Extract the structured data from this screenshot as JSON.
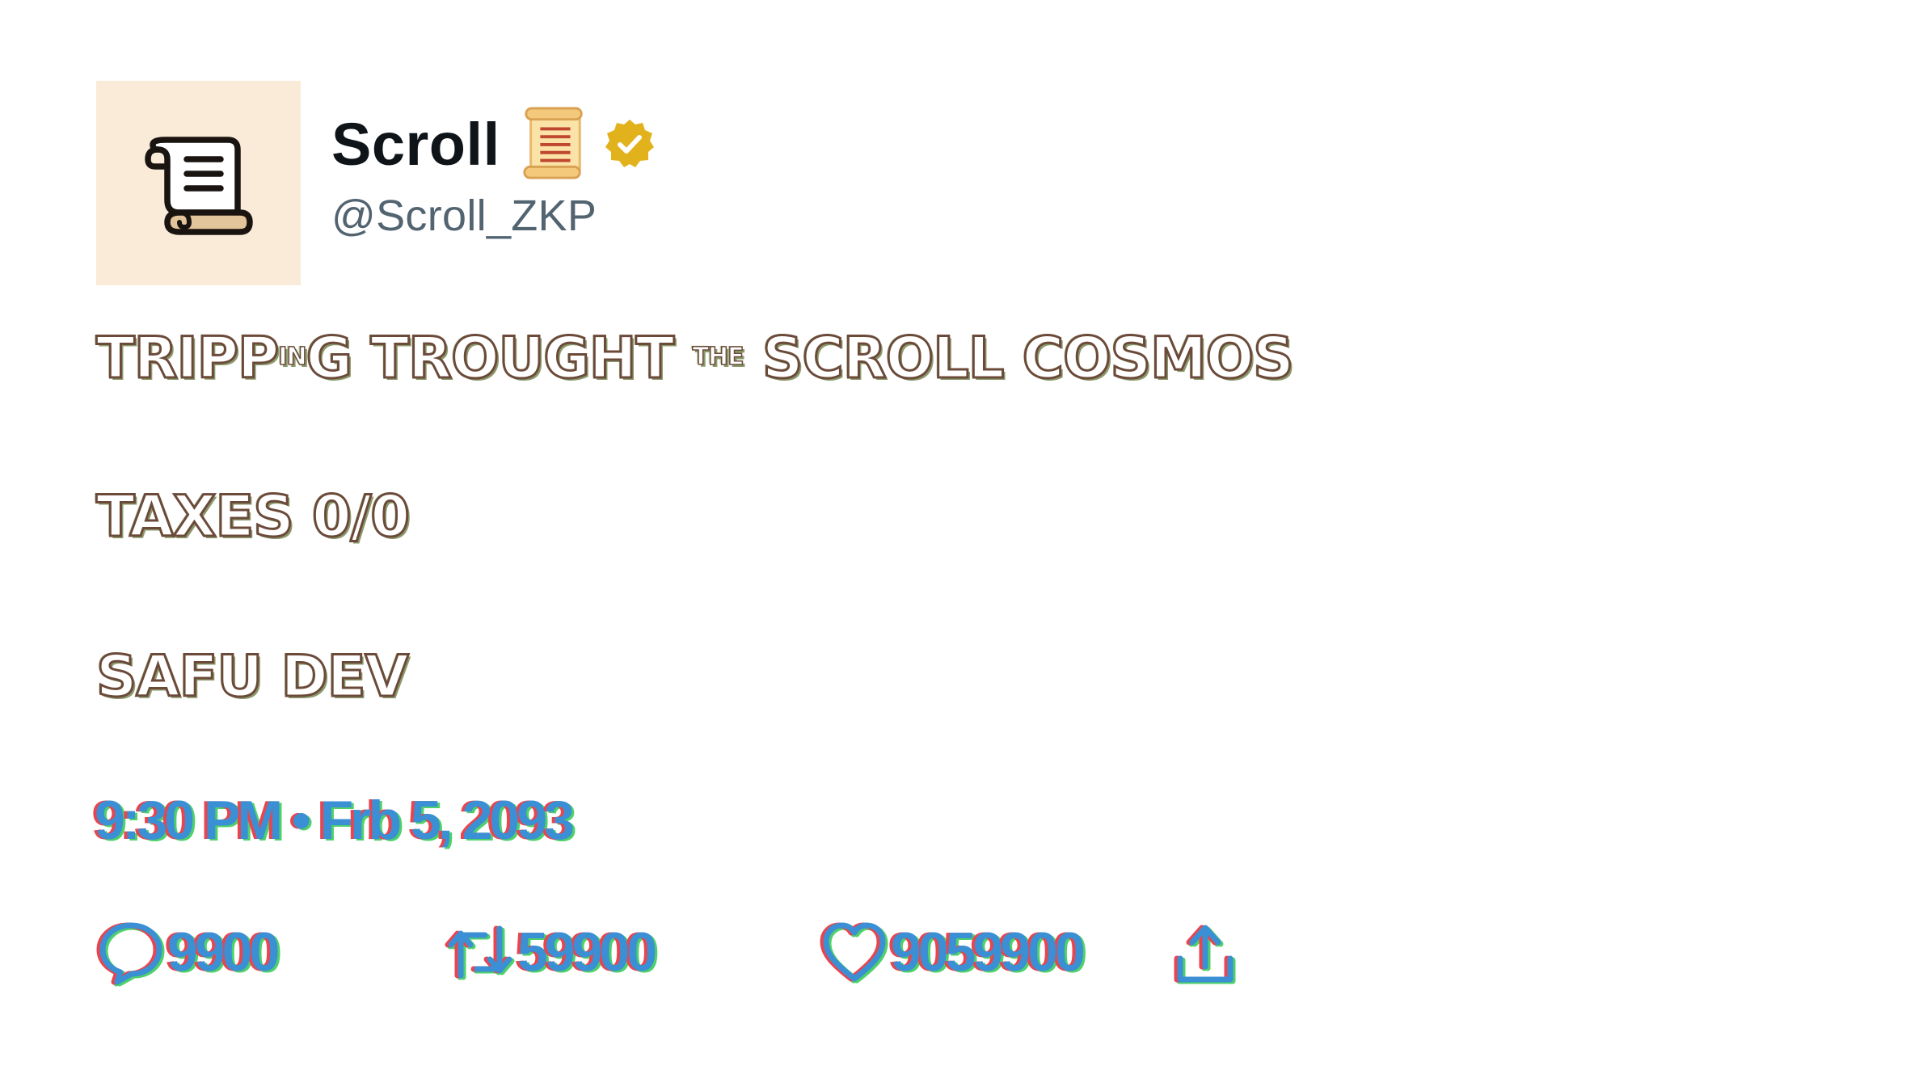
{
  "author": {
    "display_name": "Scroll",
    "handle": "@Scroll_ZKP",
    "avatar_icon": "scroll-logo-icon",
    "name_emoji": "scroll-emoji-icon",
    "verified_badge": "verified-badge-icon",
    "avatar_bg": "#faebd8",
    "badge_color": "#e2b21c"
  },
  "tweet": {
    "line1_a": "TRIPP",
    "line1_in": "IN",
    "line1_b": "G TROUGHT ",
    "line1_the": "THE",
    "line1_c": " SCROLL COSMOS",
    "line2": "TAXES 0/0",
    "line3": "SAFU DEV"
  },
  "meta": {
    "timestamp": "9:30 PM • Frb 5, 2093"
  },
  "actions": {
    "replies": "9900",
    "retweets": "59900",
    "likes": "9059900",
    "reply_icon": "reply-icon",
    "retweet_icon": "retweet-icon",
    "like_icon": "heart-icon",
    "share_icon": "share-icon"
  },
  "colors": {
    "text_primary": "#0f1419",
    "text_secondary": "#536471",
    "glitch_blue": "#3b8fd4",
    "glitch_red": "#e8454f",
    "glitch_green": "#4fd16a"
  }
}
